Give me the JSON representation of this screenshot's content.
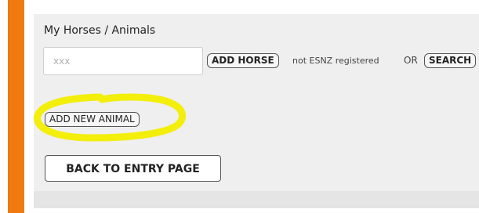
{
  "colors": {
    "sidebar_accent": "#f07a10",
    "highlight": "#f3ee0a"
  },
  "section": {
    "title": "My Horses / Animals"
  },
  "search": {
    "placeholder": "xxx"
  },
  "buttons": {
    "add_horse": "ADD HORSE",
    "search": "SEARCH",
    "add_new_animal": "ADD NEW ANIMAL",
    "back_to_entry": "BACK TO ENTRY PAGE"
  },
  "labels": {
    "not_registered": "not ESNZ registered",
    "or": "OR"
  }
}
